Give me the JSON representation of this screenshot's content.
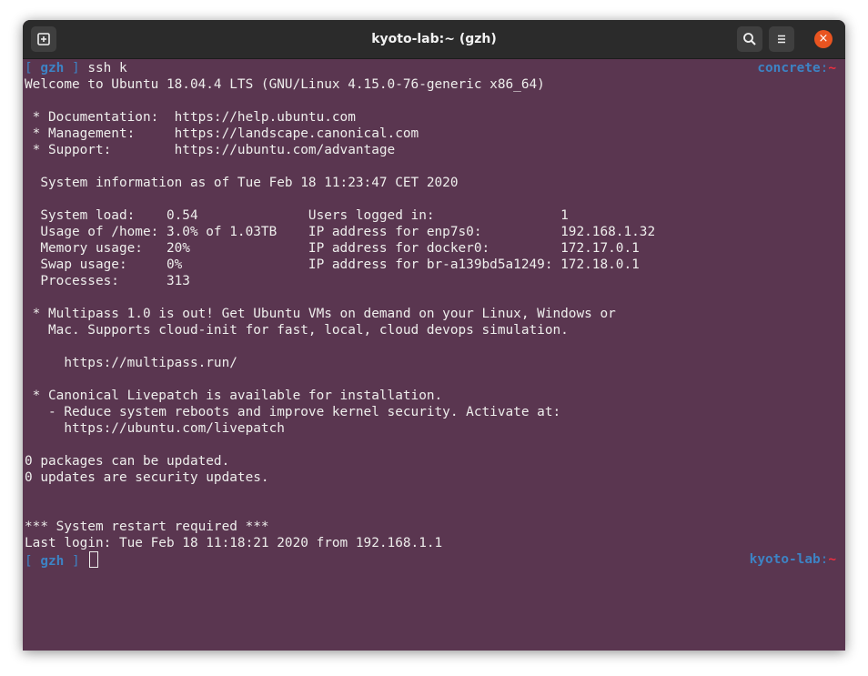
{
  "window": {
    "title": "kyoto-lab:~ (gzh)"
  },
  "titlebar": {
    "new_tab_icon": "new-tab-icon",
    "search_icon": "search-icon",
    "menu_icon": "hamburger-menu-icon",
    "close_glyph": "×"
  },
  "colors": {
    "terminal_bg": "#5a3650",
    "titlebar_bg": "#2b2b2b",
    "prompt_blue": "#3d83c4",
    "tilde_red": "#ef2f3f",
    "close_orange": "#e95420"
  },
  "prompt1": {
    "open": "[",
    "user": "gzh",
    "close": "]",
    "command": "ssh k",
    "host": "concrete",
    "colon": ":",
    "tilde": "~"
  },
  "motd": {
    "welcome": "Welcome to Ubuntu 18.04.4 LTS (GNU/Linux 4.15.0-76-generic x86_64)",
    "doc": " * Documentation:  https://help.ubuntu.com",
    "mgmt": " * Management:     https://landscape.canonical.com",
    "support": " * Support:        https://ubuntu.com/advantage",
    "sysinfo": "  System information as of Tue Feb 18 11:23:47 CET 2020",
    "row1": "  System load:    0.54              Users logged in:                1",
    "row2": "  Usage of /home: 3.0% of 1.03TB    IP address for enp7s0:          192.168.1.32",
    "row3": "  Memory usage:   20%               IP address for docker0:         172.17.0.1",
    "row4": "  Swap usage:     0%                IP address for br-a139bd5a1249: 172.18.0.1",
    "row5": "  Processes:      313",
    "mp1": " * Multipass 1.0 is out! Get Ubuntu VMs on demand on your Linux, Windows or",
    "mp2": "   Mac. Supports cloud-init for fast, local, cloud devops simulation.",
    "mp3": "     https://multipass.run/",
    "lp1": " * Canonical Livepatch is available for installation.",
    "lp2": "   - Reduce system reboots and improve kernel security. Activate at:",
    "lp3": "     https://ubuntu.com/livepatch",
    "pk1": "0 packages can be updated.",
    "pk2": "0 updates are security updates.",
    "restart": "*** System restart required ***",
    "lastlogin": "Last login: Tue Feb 18 11:18:21 2020 from 192.168.1.1"
  },
  "prompt2": {
    "open": "[",
    "user": "gzh",
    "close": "]",
    "host": "kyoto-lab",
    "colon": ":",
    "tilde": "~"
  }
}
